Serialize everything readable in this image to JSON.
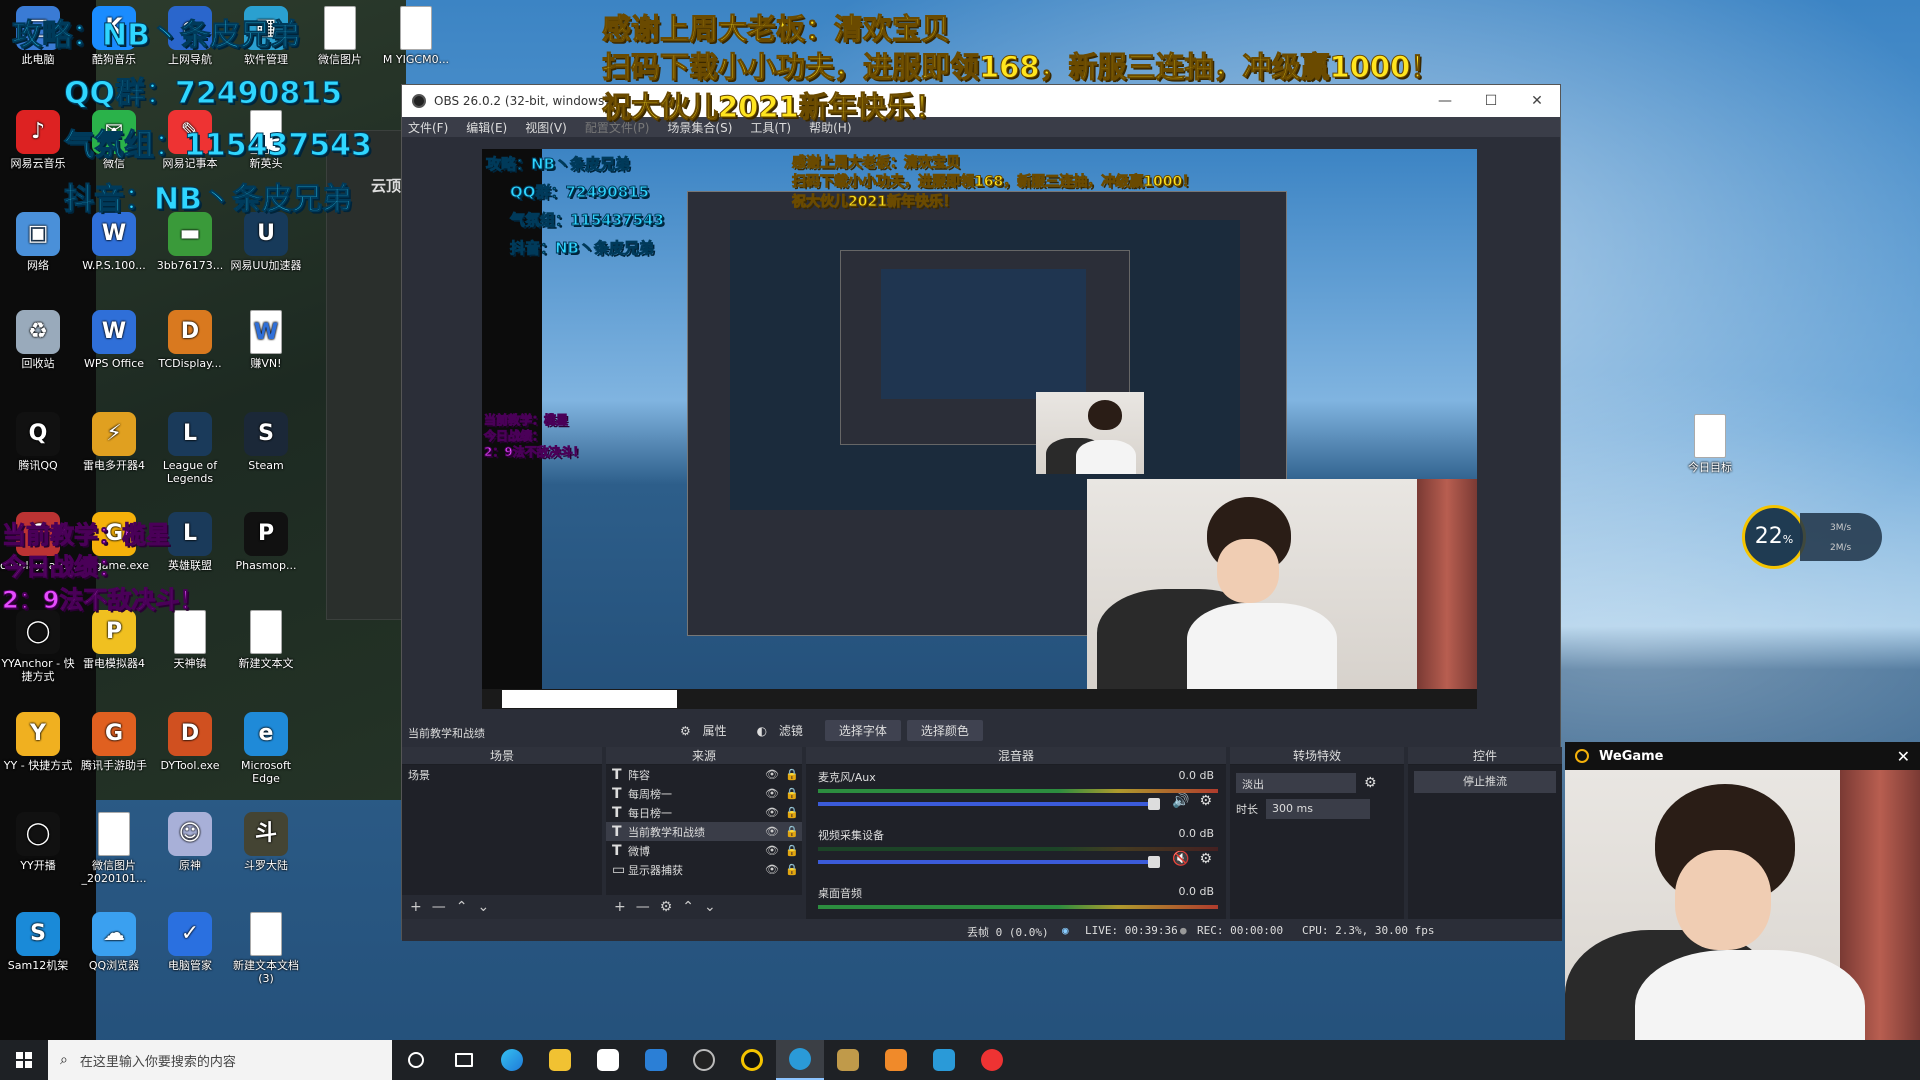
{
  "overlay": {
    "line_gonglue": "攻略：NB丶条皮兄弟",
    "line_qq": "QQ群：72490815",
    "line_qifen": "气氛组：115437543",
    "line_douyin": "抖音：NB丶条皮兄弟",
    "thanks": "感谢上周大老板：清欢宝贝",
    "promo": "扫码下载小小功夫，进服即领168，新服三连抽，冲级赢1000！",
    "newyear": "祝大伙儿2021新年快乐！",
    "teaching_1": "当前教学：榄星",
    "teaching_2": "今日战绩：",
    "teaching_3": "2：9法不敌决斗！",
    "yunding": "云顶"
  },
  "desktop_icons": [
    {
      "label": "此电脑",
      "color": "#3a7bd5",
      "glyph": "□"
    },
    {
      "label": "酷狗音乐",
      "color": "#1a8cff",
      "glyph": "K"
    },
    {
      "label": "上网导航",
      "color": "#2a66cc",
      "glyph": "e"
    },
    {
      "label": "软件管理",
      "color": "#2aa0d0",
      "glyph": "▦"
    },
    {
      "label": "微信图片",
      "color": "#ffffff",
      "glyph": ""
    },
    {
      "label": "M YIGCM0...",
      "color": "#ffffff",
      "glyph": ""
    },
    {
      "label": "网易云音乐",
      "color": "#d22",
      "glyph": "♪"
    },
    {
      "label": "微信",
      "color": "#2ab24a",
      "glyph": "✉"
    },
    {
      "label": "网易记事本",
      "color": "#e33",
      "glyph": "✎"
    },
    {
      "label": "新英头",
      "color": "#ffffff",
      "glyph": ""
    },
    {
      "label": "网络",
      "color": "#4a90d9",
      "glyph": "▣"
    },
    {
      "label": "W.P.S.100...",
      "color": "#2f6fd8",
      "glyph": "W"
    },
    {
      "label": "3bb76173...",
      "color": "#3a9a3a",
      "glyph": "▬"
    },
    {
      "label": "网易UU加速器",
      "color": "#173a5a",
      "glyph": "U"
    },
    {
      "label": "回收站",
      "color": "#9ab",
      "glyph": "♻"
    },
    {
      "label": "WPS Office",
      "color": "#2f6fd8",
      "glyph": "W"
    },
    {
      "label": "TCDisplay...",
      "color": "#d9791f",
      "glyph": "D"
    },
    {
      "label": "赚VN!",
      "color": "#ffffff",
      "glyph": "W"
    },
    {
      "label": "腾讯QQ",
      "color": "#111",
      "glyph": "Q"
    },
    {
      "label": "雷电多开器4",
      "color": "#e0a020",
      "glyph": "⚡"
    },
    {
      "label": "League of Legends",
      "color": "#1a3a5a",
      "glyph": "L"
    },
    {
      "label": "Steam",
      "color": "#1b2838",
      "glyph": "S"
    },
    {
      "label": "cosplaypatch...",
      "color": "#b33",
      "glyph": "C"
    },
    {
      "label": "wegame.exe",
      "color": "#f5b10a",
      "glyph": "G"
    },
    {
      "label": "英雄联盟",
      "color": "#1a3a5a",
      "glyph": "L"
    },
    {
      "label": "Phasmop...",
      "color": "#111",
      "glyph": "P"
    },
    {
      "label": "YYAnchor - 快捷方式",
      "color": "#111",
      "glyph": "◯"
    },
    {
      "label": "雷电模拟器4",
      "color": "#f0c020",
      "glyph": "P"
    },
    {
      "label": "天神镇",
      "color": "#ffffff",
      "glyph": ""
    },
    {
      "label": "新建文本文",
      "color": "#ffffff",
      "glyph": ""
    },
    {
      "label": "YY - 快捷方式",
      "color": "#f0b020",
      "glyph": "Y"
    },
    {
      "label": "腾讯手游助手",
      "color": "#e06020",
      "glyph": "G"
    },
    {
      "label": "DYTool.exe",
      "color": "#d05020",
      "glyph": "D"
    },
    {
      "label": "Microsoft Edge",
      "color": "#1f8ad8",
      "glyph": "e"
    },
    {
      "label": "YY开播",
      "color": "#111",
      "glyph": "◯"
    },
    {
      "label": "微信图片_2020101...",
      "color": "#ffffff",
      "glyph": ""
    },
    {
      "label": "原神",
      "color": "#a8b0d8",
      "glyph": "☺"
    },
    {
      "label": "斗罗大陆",
      "color": "#443",
      "glyph": "斗"
    },
    {
      "label": "Sam12机架",
      "color": "#1a8ad8",
      "glyph": "S"
    },
    {
      "label": "QQ浏览器",
      "color": "#3aa0f0",
      "glyph": "☁"
    },
    {
      "label": "电脑管家",
      "color": "#2a70e0",
      "glyph": "✓"
    },
    {
      "label": "新建文本文档 (3)",
      "color": "#ffffff",
      "glyph": ""
    },
    {
      "label": "今日目标",
      "color": "#ffffff",
      "glyph": ""
    }
  ],
  "obs": {
    "title": "OBS 26.0.2 (32-bit, windows)",
    "menu": [
      "文件(F)",
      "编辑(E)",
      "视图(V)",
      "配置文件(P)",
      "场景集合(S)",
      "工具(T)",
      "帮助(H)"
    ],
    "selected_source": "当前教学和战绩",
    "toolbar": {
      "properties": "属性",
      "filters": "滤镜",
      "select_font": "选择字体",
      "select_color": "选择颜色"
    },
    "docks": {
      "scenes": "场景",
      "sources": "来源",
      "mixer": "混音器",
      "transitions": "转场特效",
      "controls": "控件"
    },
    "scenes": [
      "场景"
    ],
    "sources": [
      "阵容",
      "每周榜一",
      "每日榜一",
      "当前教学和战绩",
      "微博",
      "显示器捕获"
    ],
    "mixer": [
      {
        "name": "麦克风/Aux",
        "db": "0.0 dB"
      },
      {
        "name": "视频采集设备",
        "db": "0.0 dB"
      },
      {
        "name": "桌面音频",
        "db": "0.0 dB"
      }
    ],
    "transition": {
      "type": "淡出",
      "duration_label": "时长",
      "duration": "300 ms"
    },
    "controls": {
      "start_streaming": "停止推流"
    },
    "status": {
      "dropped": "丢帧 0 (0.0%)",
      "live": "LIVE: 00:39:36",
      "rec": "REC: 00:00:00",
      "cpu": "CPU: 2.3%, 30.00 fps"
    }
  },
  "wegame": {
    "title": "WeGame"
  },
  "gauge": {
    "value": "22",
    "unit": "%",
    "up": "3M/s",
    "down": "2M/s"
  },
  "taskbar": {
    "search_placeholder": "在这里输入你要搜索的内容",
    "pinned": [
      "cortana-icon",
      "task-view-icon",
      "edge-icon",
      "file-explorer-icon",
      "store-icon",
      "mail-icon",
      "obs-icon",
      "yy-icon",
      "wegame-icon",
      "league-icon",
      "taskbar-app-icon",
      "sam-icon",
      "netease-music-icon"
    ]
  },
  "colors": {
    "overlay_cyan": "#2fd6ff",
    "overlay_yellow": "#ffe51f",
    "overlay_magenta": "#e74bff",
    "obs_bg": "#2b2e38"
  }
}
